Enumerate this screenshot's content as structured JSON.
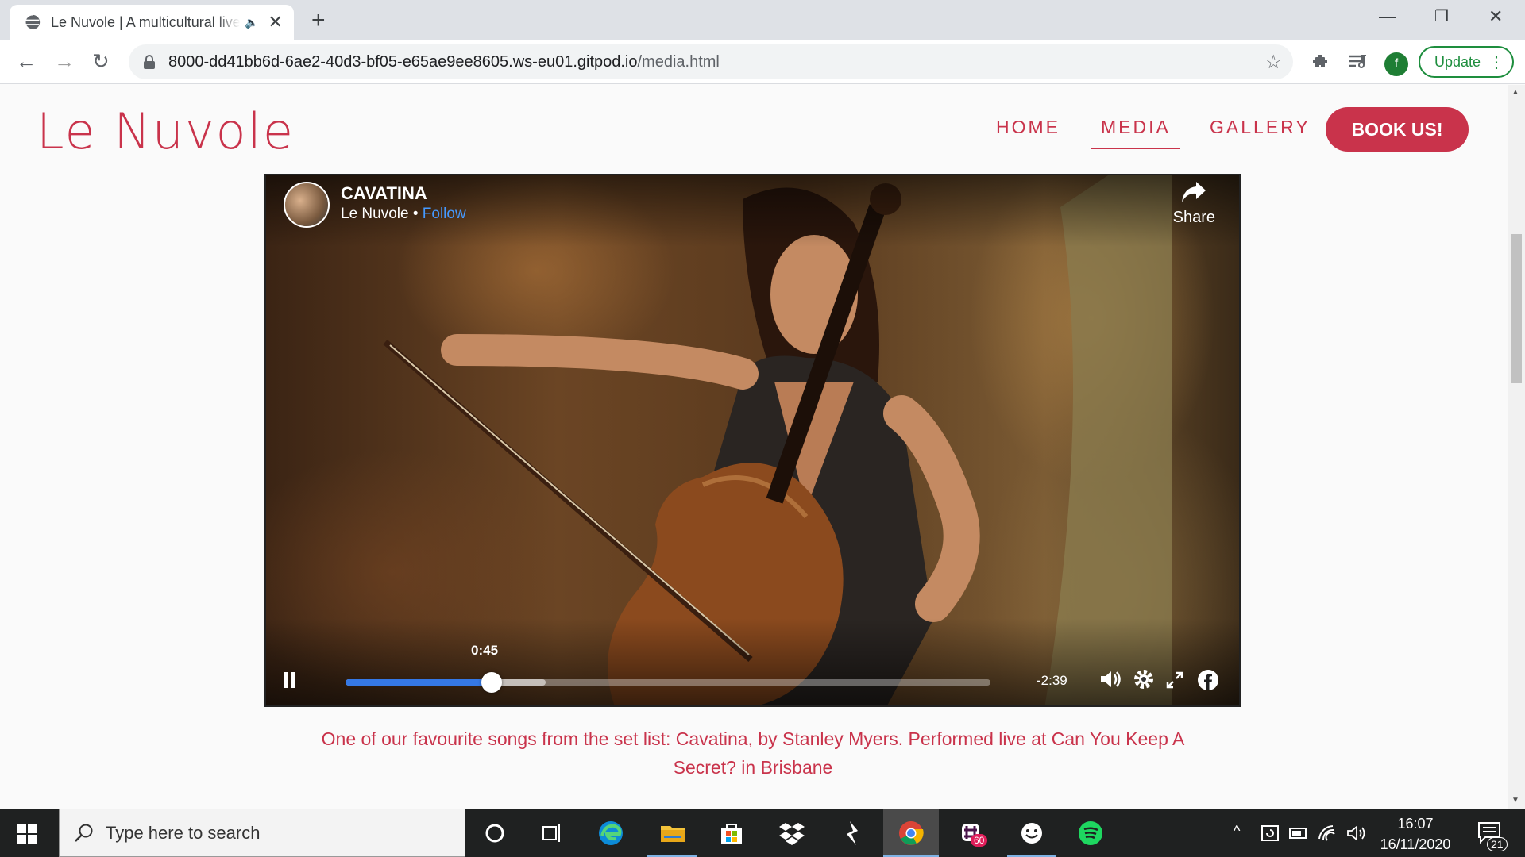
{
  "browser": {
    "tab_title": "Le Nuvole | A multicultural live band",
    "url_host": "8000-dd41bb6d-6ae2-40d3-bf05-e65ae9ee8605.ws-eu01.gitpod.io",
    "url_path": "/media.html",
    "profile_initial": "f",
    "update_label": "Update"
  },
  "site": {
    "logo": "Le Nuvole",
    "nav": {
      "home": "HOME",
      "media": "MEDIA",
      "gallery": "GALLERY",
      "book": "BOOK US!"
    },
    "active_nav": "MEDIA"
  },
  "video": {
    "title": "CAVATINA",
    "channel": "Le Nuvole",
    "separator": " • ",
    "follow": "Follow",
    "share": "Share",
    "current_time": "0:45",
    "remaining_time": "-2:39",
    "progress_fraction": 0.227,
    "buffered_fraction": 0.31,
    "state": "playing"
  },
  "caption": "One of our favourite songs from the set list: Cavatina, by Stanley Myers. Performed live at Can You Keep A Secret? in Brisbane",
  "taskbar": {
    "search_placeholder": "Type here to search",
    "slack_badge": "60",
    "time": "16:07",
    "date": "16/11/2020",
    "notifications": "21"
  },
  "colors": {
    "brand": "#c9334b",
    "progress": "#3578e5",
    "facebook_link": "#4599ff"
  }
}
